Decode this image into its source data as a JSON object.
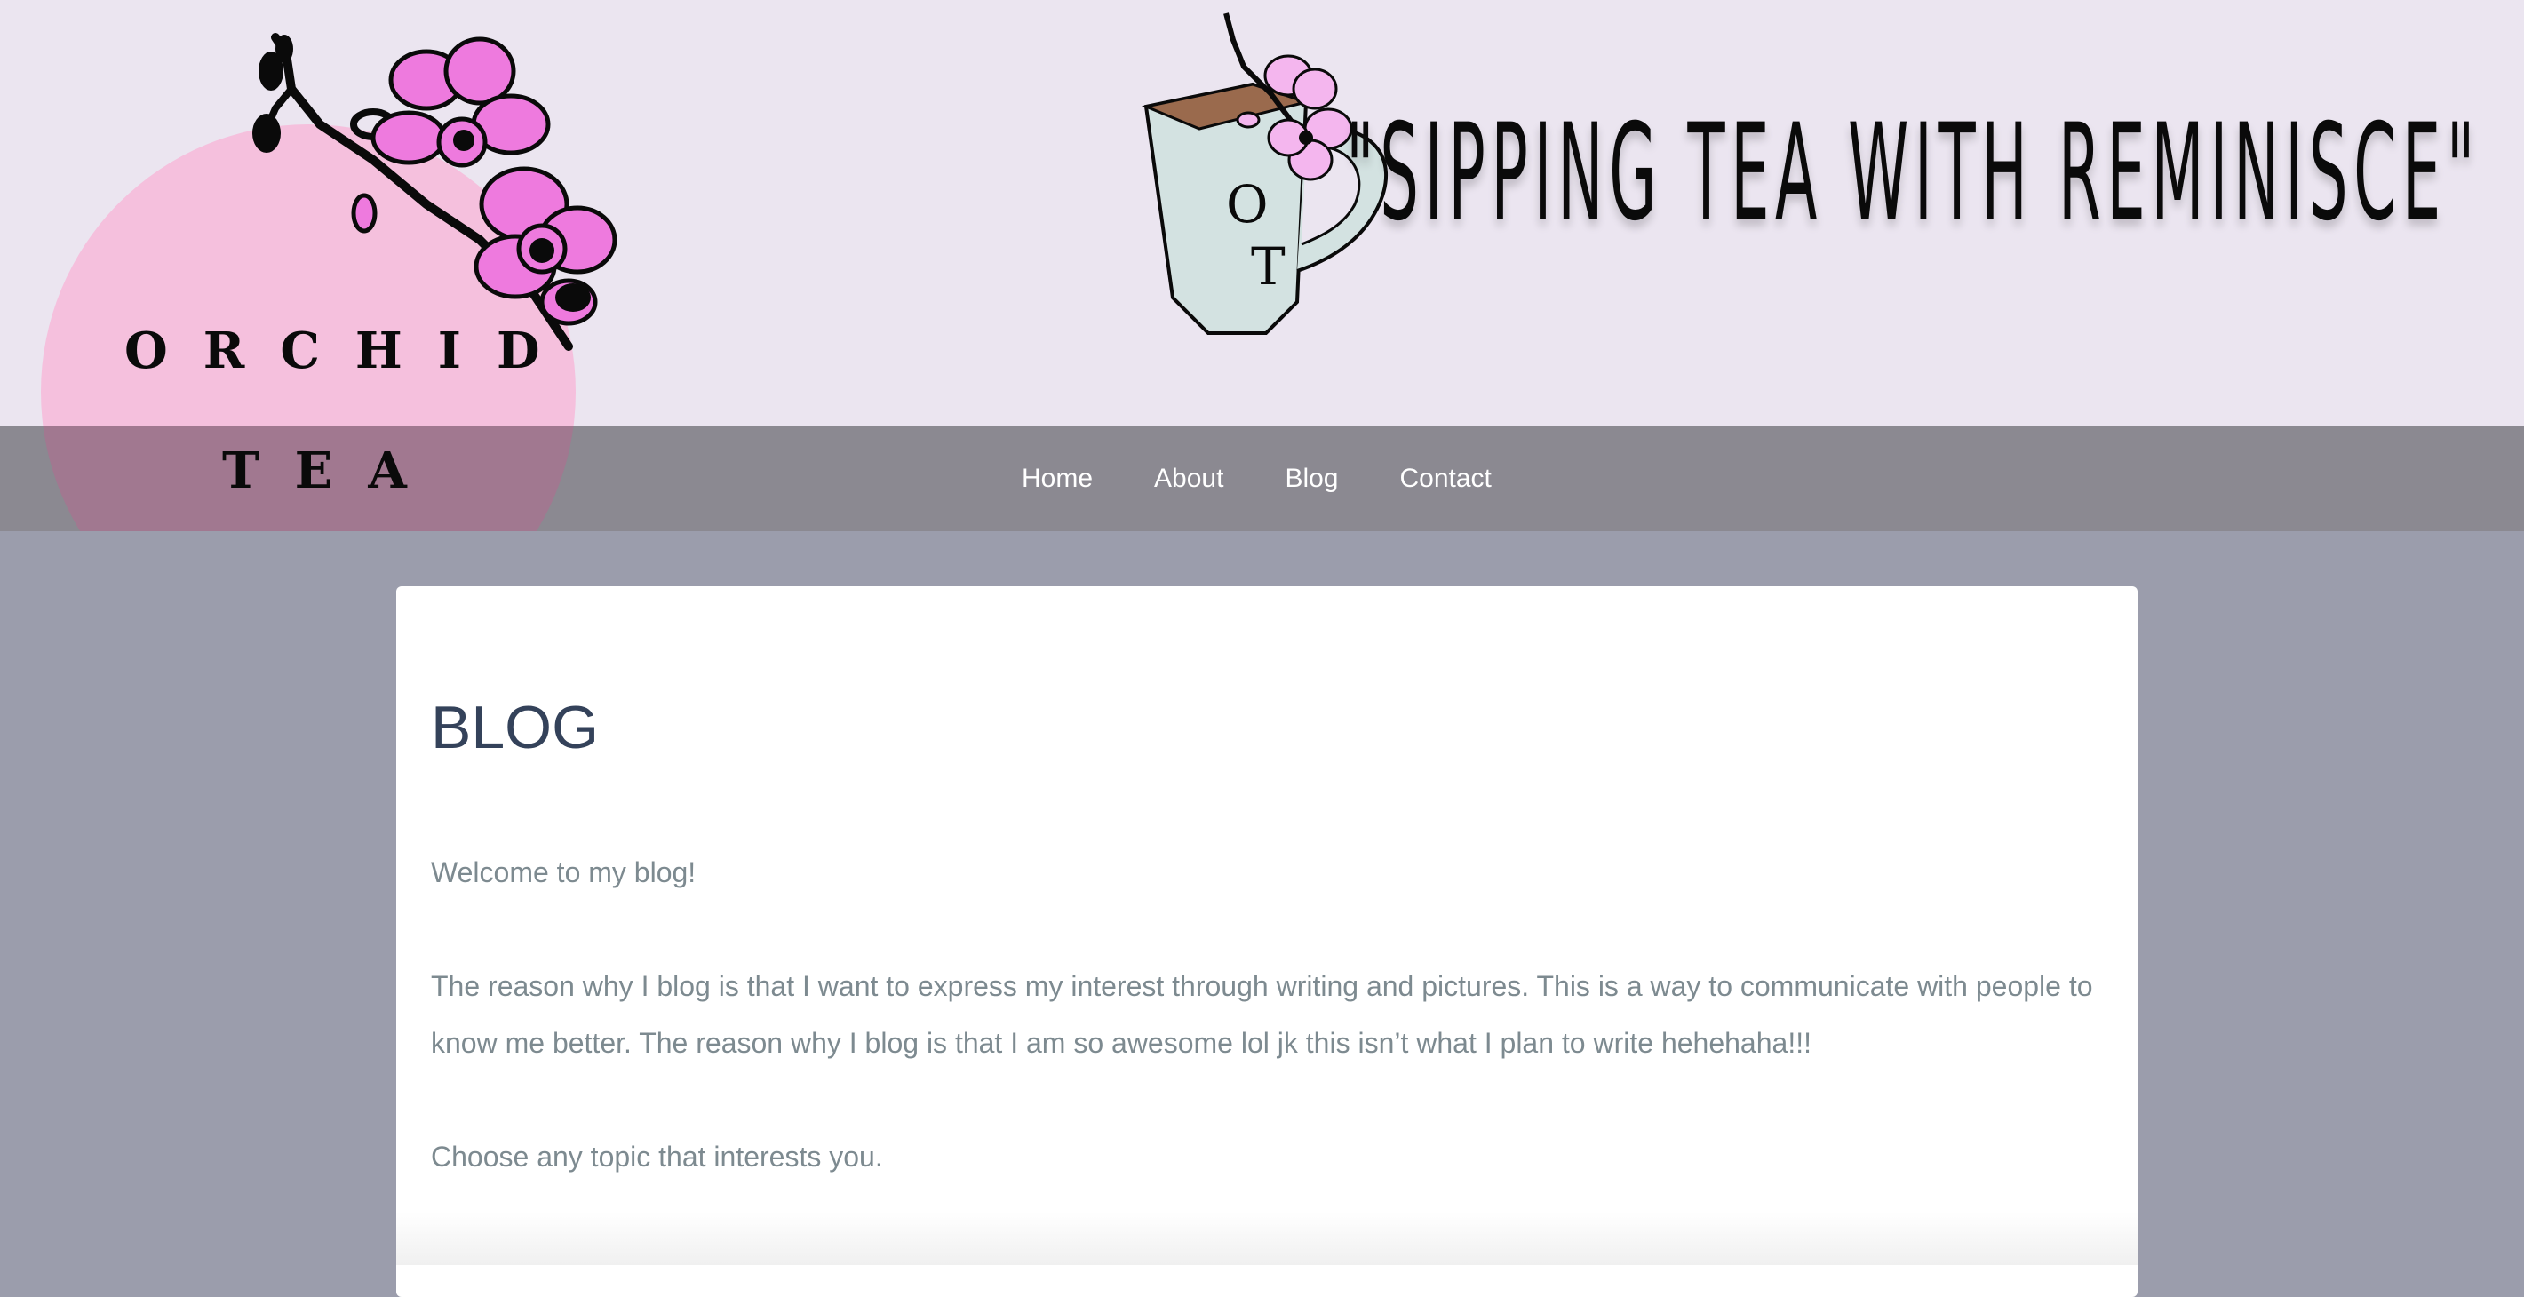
{
  "logo": {
    "word1": "ORCHID",
    "word2": "TEA",
    "circle_color": "#f5c0dd",
    "flower_color": "#ee7ade"
  },
  "banner": {
    "cup_letters": [
      "O",
      "T"
    ],
    "tagline": "\"SIPPING TEA WITH REMINISCE\""
  },
  "nav": {
    "items": [
      {
        "label": "Home"
      },
      {
        "label": "About"
      },
      {
        "label": "Blog"
      },
      {
        "label": "Contact"
      }
    ]
  },
  "main": {
    "title": "BLOG",
    "paragraphs": [
      "Welcome to my blog!",
      "The reason why I blog is that I want to express my interest through writing and pictures. This is a way to communicate with people to know me better. The reason why I blog is that I am so awesome lol jk this isn’t what I plan to write hehehaha!!!",
      "Choose any topic that interests you."
    ]
  },
  "colors": {
    "header_bg": "#ebe5f0",
    "nav_bg": "#89878e",
    "page_bg": "#9b9dac",
    "title": "#34425a",
    "body_text": "#7d8a90"
  }
}
